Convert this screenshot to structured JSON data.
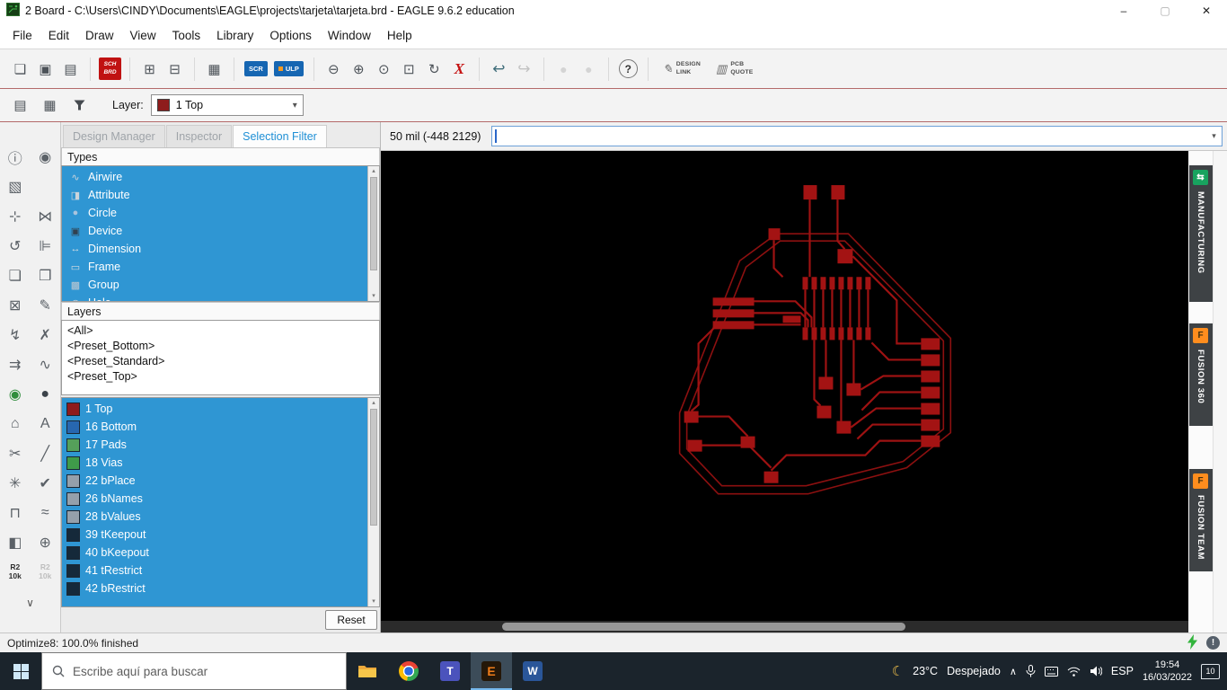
{
  "window": {
    "title": "2 Board - C:\\Users\\CINDY\\Documents\\EAGLE\\projects\\tarjeta\\tarjeta.brd - EAGLE 9.6.2 education",
    "minimize": "–",
    "restore": "▢",
    "close": "✕"
  },
  "menubar": {
    "items": [
      "File",
      "Edit",
      "Draw",
      "View",
      "Tools",
      "Library",
      "Options",
      "Window",
      "Help"
    ]
  },
  "toolbar": {
    "sch": "SCH",
    "brd": "BRD",
    "scr": "SCR",
    "ulp": "ULP",
    "design1": "DESIGN",
    "design2": "LINK",
    "quote1": "PCB",
    "quote2": "QUOTE",
    "help": "?"
  },
  "layerbar": {
    "label": "Layer:",
    "selected": "1 Top",
    "color": "#8e1c1c"
  },
  "panel": {
    "tabs": [
      {
        "label": "Design Manager"
      },
      {
        "label": "Inspector"
      },
      {
        "label": "Selection Filter",
        "active": true
      }
    ],
    "types_header": "Types",
    "types": [
      {
        "name": "type-airwire",
        "icon": "∿",
        "label": "Airwire",
        "ic": "#ccd4db"
      },
      {
        "name": "type-attribute",
        "icon": "◨",
        "label": "Attribute",
        "ic": "#ccd4db"
      },
      {
        "name": "type-circle",
        "icon": "●",
        "label": "Circle",
        "ic": "#a9c4de"
      },
      {
        "name": "type-device",
        "icon": "▣",
        "label": "Device",
        "ic": "#31414f"
      },
      {
        "name": "type-dimension",
        "icon": "↔",
        "label": "Dimension",
        "ic": "#d7dde2"
      },
      {
        "name": "type-frame",
        "icon": "▭",
        "label": "Frame",
        "ic": "#d7dde2"
      },
      {
        "name": "type-group",
        "icon": "▩",
        "label": "Group",
        "ic": "#bfc9d2"
      },
      {
        "name": "type-hole",
        "icon": "◎",
        "label": "Hole",
        "ic": "#d7dde2"
      }
    ],
    "layers_header": "Layers",
    "presets": [
      "<All>",
      "<Preset_Bottom>",
      "<Preset_Standard>",
      "<Preset_Top>"
    ],
    "layers": [
      {
        "name": "layer-1-top",
        "label": "1 Top",
        "color": "#8e1c1c"
      },
      {
        "name": "layer-16-bottom",
        "label": "16 Bottom",
        "color": "#2767b0"
      },
      {
        "name": "layer-17-pads",
        "label": "17 Pads",
        "color": "#55a05a"
      },
      {
        "name": "layer-18-vias",
        "label": "18 Vias",
        "color": "#3f9b4a"
      },
      {
        "name": "layer-22-bplace",
        "label": "22 bPlace",
        "color": "#95a0ab"
      },
      {
        "name": "layer-26-bnames",
        "label": "26 bNames",
        "color": "#95a0ab"
      },
      {
        "name": "layer-28-bvalues",
        "label": "28 bValues",
        "color": "#95a0ab"
      },
      {
        "name": "layer-39-tkeepout",
        "label": "39 tKeepout",
        "color": "#15293a",
        "cls": "hatch"
      },
      {
        "name": "layer-40-bkeepout",
        "label": "40 bKeepout",
        "color": "#15293a",
        "cls": "hatch"
      },
      {
        "name": "layer-41-trestrict",
        "label": "41 tRestrict",
        "color": "#15293a",
        "cls": "hatch"
      },
      {
        "name": "layer-42-brestrict",
        "label": "42 bRestrict",
        "color": "#15293a",
        "cls": "hatch"
      }
    ],
    "reset": "Reset"
  },
  "tools": {
    "items": [
      {
        "name": "info-button",
        "glyph": "ⓘ"
      },
      {
        "name": "display-button",
        "glyph": "◉"
      },
      {
        "name": "group-button",
        "glyph": "▧"
      },
      {
        "name": "",
        "glyph": ""
      },
      {
        "name": "move-button",
        "glyph": "⊹"
      },
      {
        "name": "mirror-button",
        "glyph": "⋈"
      },
      {
        "name": "rotate-button",
        "glyph": "↺"
      },
      {
        "name": "align-button",
        "glyph": "⊫"
      },
      {
        "name": "copy-button",
        "glyph": "❏"
      },
      {
        "name": "paste-button",
        "glyph": "❐"
      },
      {
        "name": "delete-button",
        "glyph": "⊠"
      },
      {
        "name": "change-button",
        "glyph": "✎"
      },
      {
        "name": "route-button",
        "glyph": "↯"
      },
      {
        "name": "ripup-button",
        "glyph": "✗"
      },
      {
        "name": "diffpair-button",
        "glyph": "⇉"
      },
      {
        "name": "meander-button",
        "glyph": "∿"
      },
      {
        "name": "via-button",
        "glyph": "◉",
        "ic": "#2f8d3c"
      },
      {
        "name": "circle-button",
        "glyph": "●",
        "ic": "#3c434a"
      },
      {
        "name": "polygon-button",
        "glyph": "⌂"
      },
      {
        "name": "text-button",
        "glyph": "A"
      },
      {
        "name": "split-button",
        "glyph": "✂"
      },
      {
        "name": "miter-button",
        "glyph": "╱"
      },
      {
        "name": "ratsnest-button",
        "glyph": "✳"
      },
      {
        "name": "drc-button",
        "glyph": "✔"
      },
      {
        "name": "footprint-button",
        "glyph": "⊓"
      },
      {
        "name": "signal-button",
        "glyph": "≈"
      },
      {
        "name": "package-button",
        "glyph": "◧"
      },
      {
        "name": "drill-button",
        "glyph": "⊕"
      }
    ],
    "res_top": "R2",
    "res_bottom": "10k",
    "more": "∨"
  },
  "canvas": {
    "coord": "50 mil (-448 2129)",
    "dropdown": "▾"
  },
  "side_buttons": [
    {
      "name": "manufacturing-button",
      "label": "MANUFACTURING",
      "icon": "⇆",
      "bg": "#18a35f",
      "fg": "#ffffff"
    },
    {
      "name": "fusion-360-button",
      "label": "FUSION 360",
      "icon": "F",
      "bg": "#ff8d1e",
      "fg": "#42300f"
    },
    {
      "name": "fusion-team-button",
      "label": "FUSION TEAM",
      "icon": "F",
      "bg": "#ff8d1e",
      "fg": "#42300f"
    }
  ],
  "statusbar": {
    "text": "Optimize8: 100.0% finished"
  },
  "taskbar": {
    "search": "Escribe aquí para buscar",
    "temp": "23°C",
    "desc": "Despejado",
    "lang": "ESP",
    "time": "19:54",
    "date": "16/03/2022",
    "badge": "10"
  }
}
